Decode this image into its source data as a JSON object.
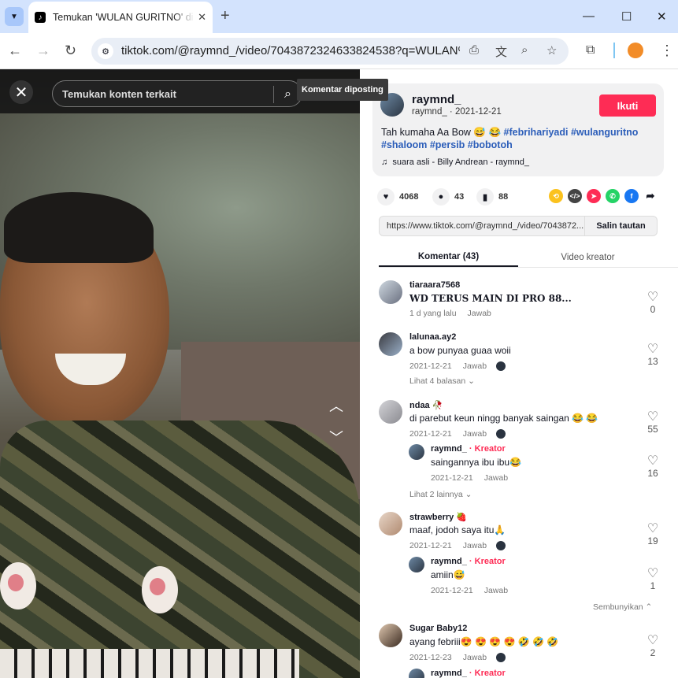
{
  "browser": {
    "tab_title": "Temukan 'WULAN GURITNO' di TikTok",
    "tab_favicon": "♪",
    "url": "tiktok.com/@raymnd_/video/7043872324633824538?q=WULAN%2..."
  },
  "video": {
    "search_placeholder": "Temukan konten terkait",
    "tooltip": "Komentar diposting"
  },
  "post": {
    "author": "raymnd_",
    "sub": "raymnd_ · 2021-12-21",
    "follow": "Ikuti",
    "desc_plain": "Tah kumaha Aa Bow 😅 😂 ",
    "tags": [
      "#febrihariyadi",
      "#wulanguritno",
      "#shaloom",
      "#persib",
      "#bobotoh"
    ],
    "music": "suara asli - Billy Andrean - raymnd_",
    "likes": "4068",
    "comments": "43",
    "saves": "88",
    "link": "https://www.tiktok.com/@raymnd_/video/7043872...",
    "copy": "Salin tautan",
    "tab_comments": "Komentar (43)",
    "tab_creator": "Video kreator"
  },
  "comments": [
    {
      "user": "tiaraara7568",
      "text": "WD TERUS MAIN DI PRO 88...",
      "date": "1 d yang lalu",
      "reply": "Jawab",
      "likes": "0"
    },
    {
      "user": "lalunaa.ay2",
      "text": "a bow punyaa guaa woii",
      "date": "2021-12-21",
      "reply": "Jawab",
      "likes": "13",
      "more": "Lihat 4 balasan"
    },
    {
      "user": "ndaa 🥀",
      "text": "di parebut keun ningg banyak saingan 😂 😂",
      "date": "2021-12-21",
      "reply": "Jawab",
      "likes": "55"
    },
    {
      "user": "raymnd_",
      "badge": "· Kreator",
      "text": "saingannya ibu ibu😂",
      "date": "2021-12-21",
      "reply": "Jawab",
      "likes": "16",
      "more": "Lihat 2 lainnya"
    },
    {
      "user": "strawberry 🍓",
      "text": "maaf, jodoh saya itu🙏",
      "date": "2021-12-21",
      "reply": "Jawab",
      "likes": "19"
    },
    {
      "user": "raymnd_",
      "badge": "· Kreator",
      "text": "amiin😅",
      "date": "2021-12-21",
      "reply": "Jawab",
      "likes": "1",
      "more": "Sembunyikan"
    },
    {
      "user": "Sugar Baby12",
      "text": "ayang febriii😍 😍 😍 😍 🤣 🤣 🤣",
      "date": "2021-12-23",
      "reply": "Jawab",
      "likes": "2"
    },
    {
      "user": "raymnd_",
      "badge": "· Kreator"
    }
  ],
  "colors": {
    "accent": "#fe2c55",
    "tag": "#2b5db9"
  }
}
